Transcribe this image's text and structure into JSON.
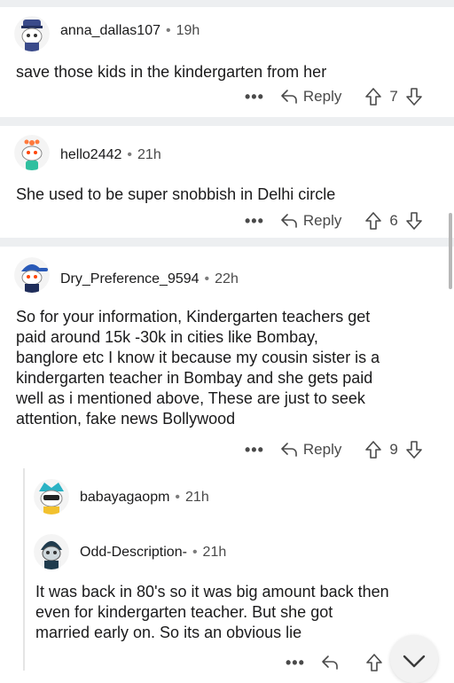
{
  "comments": [
    {
      "username": "anna_dallas107",
      "time": "19h",
      "body": "save those kids in the kindergarten from her",
      "more": "•••",
      "reply_label": "Reply",
      "votes": "7"
    },
    {
      "username": "hello2442",
      "time": "21h",
      "body": "She used to be super snobbish in Delhi circle",
      "more": "•••",
      "reply_label": "Reply",
      "votes": "6"
    },
    {
      "username": "Dry_Preference_9594",
      "time": "22h",
      "body_lines": [
        "So for your information, Kindergarten teachers get",
        "paid around 15k -30k  in cities like Bombay,",
        "banglore etc I know it because my cousin sister is a",
        "kindergarten teacher in Bombay and she gets paid",
        "well as i mentioned above, These are just to seek",
        "attention, fake news Bollywood"
      ],
      "more": "•••",
      "reply_label": "Reply",
      "votes": "9"
    }
  ],
  "replies": [
    {
      "username": "babayagaopm",
      "time": "21h"
    },
    {
      "username": "Odd-Description-",
      "time": "21h",
      "body_lines": [
        "It was back in 80's so it was big amount back then",
        "even for kindergarten teacher. But she got",
        "married early on. So its an obvious lie"
      ],
      "more": "•••"
    }
  ],
  "meta_separator": "•",
  "colors": {
    "divider": "#edeff1",
    "text": "#1a1a1b",
    "muted": "#4a4a4a"
  }
}
